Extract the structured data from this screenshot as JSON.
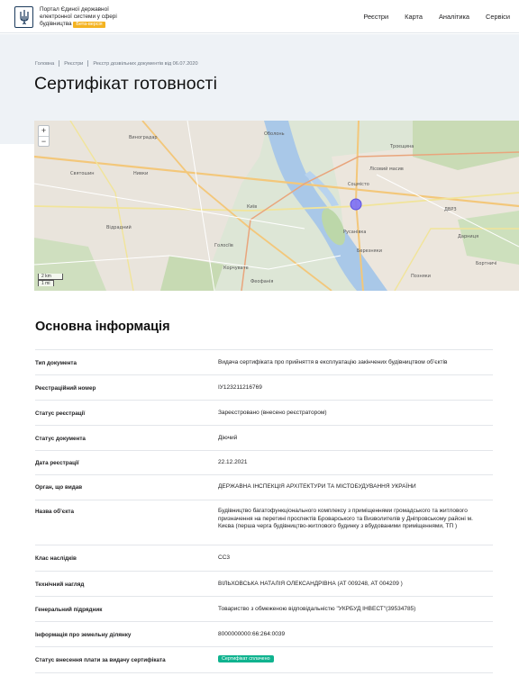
{
  "header": {
    "brand_line1": "Портал Єдиної державної",
    "brand_line2": "електронної системи у сфері",
    "brand_line3": "будівництва",
    "beta_badge": "Бета-версія",
    "nav": [
      "Реєстри",
      "Карта",
      "Аналітика",
      "Сервіси"
    ]
  },
  "breadcrumb": [
    "Головна",
    "Реєстри",
    "Реєстр дозвільних документів від 06.07.2020"
  ],
  "page_title": "Сертифікат готовності",
  "map": {
    "zoom_in": "+",
    "zoom_out": "−",
    "scale_km": "2 km",
    "scale_mi": "1 mi",
    "labels": [
      "Київ",
      "Русанівка",
      "Лісовий масив",
      "Оболонь",
      "Березняки",
      "Позняки",
      "Троєщина",
      "ДВРЗ",
      "Дарниця",
      "Соцмісто",
      "Бортничі",
      "Голосіїв",
      "Корчувате",
      "Виноградар",
      "Святошин",
      "Нивки",
      "Відрадний",
      "Феофанія"
    ],
    "marker_color": "#7b6ef6"
  },
  "section_title": "Основна інформація",
  "rows": [
    {
      "key": "Тип документа",
      "value": "Видача сертифіката про прийняття в експлуатацію закінчених будівництвом об’єктів"
    },
    {
      "key": "Реєстраційний номер",
      "value": "ІУ123211216769"
    },
    {
      "key": "Статус реєстрації",
      "value": "Зареєстровано (внесено реєстратором)"
    },
    {
      "key": "Статус документа",
      "value": "Діючий"
    },
    {
      "key": "Дата реєстрації",
      "value": "22.12.2021"
    },
    {
      "key": "Орган, що видав",
      "value": "ДЕРЖАВНА ІНСПЕКЦІЯ АРХІТЕКТУРИ ТА МІСТОБУДУВАННЯ УКРАЇНИ"
    },
    {
      "key": "Назва об’єкта",
      "value": "Будівництво багатофункціонального комплексу з приміщеннями громадського та житлового призначення на перетині проспектів Броварського та Визволителів у Дніпровському районі м. Києва (перша черга будівництво-житлового будинку з вбудованими приміщеннями, ТП )"
    },
    {
      "key": "Клас наслідків",
      "value": "СС3"
    },
    {
      "key": "Технічний нагляд",
      "value": "ВІЛЬХОВСЬКА НАТАЛІЯ ОЛЕКСАНДРІВНА (АТ 009248, АТ 004209 )"
    },
    {
      "key": "Генеральний підрядник",
      "value": "Товариство з обмеженою відповідальністю \"УКРБУД ІНВЕСТ\"(39534785)"
    },
    {
      "key": "Інформація про земельну ділянку",
      "value": "8000000000:66:264:0039"
    },
    {
      "key": "Статус внесення плати за видачу сертифіката",
      "value": "Сертифікат сплачено"
    }
  ]
}
